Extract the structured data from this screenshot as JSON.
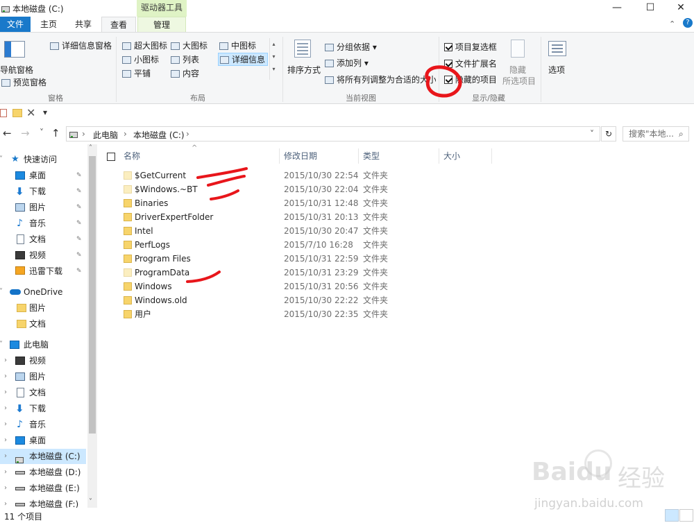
{
  "window": {
    "title": "本地磁盘 (C:)",
    "min_glyph": "—",
    "max_glyph": "☐",
    "close_glyph": "✕"
  },
  "tabs": {
    "context_header": "驱动器工具",
    "file": "文件",
    "home": "主页",
    "share": "共享",
    "view": "查看",
    "manage": "管理",
    "help_glyph": "?",
    "collapse_glyph": "⌃"
  },
  "ribbon": {
    "panes": {
      "label": "窗格",
      "nav_pane": "导航窗格",
      "preview_pane": "预览窗格",
      "details_pane": "详细信息窗格"
    },
    "layout": {
      "label": "布局",
      "items": [
        "超大图标",
        "大图标",
        "中图标",
        "小图标",
        "列表",
        "详细信息",
        "平铺",
        "内容"
      ]
    },
    "current_view": {
      "label": "当前视图",
      "sort_by": "排序方式",
      "group_by": "分组依据",
      "add_columns": "添加列",
      "fit_columns": "将所有列调整为合适的大小"
    },
    "show_hide": {
      "label": "显示/隐藏",
      "item_checkboxes": "项目复选框",
      "file_extensions": "文件扩展名",
      "hidden_items": "隐藏的项目",
      "hide_selected_1": "隐藏",
      "hide_selected_2": "所选项目",
      "options": "选项"
    }
  },
  "qat": {
    "dropdown_glyph": "▾"
  },
  "address": {
    "back_glyph": "←",
    "forward_glyph": "→",
    "recent_glyph": "˅",
    "up_glyph": "↑",
    "sep_glyph": "›",
    "crumbs": [
      "此电脑",
      "本地磁盘 (C:)"
    ],
    "dropdown_glyph": "˅",
    "refresh_glyph": "↻",
    "search_placeholder": "搜索\"本地...",
    "search_glyph": "⌕"
  },
  "nav": {
    "quick_access": "快速访问",
    "quick_items": [
      "桌面",
      "下载",
      "图片",
      "音乐",
      "文档",
      "视频",
      "迅雷下载"
    ],
    "onedrive": "OneDrive",
    "onedrive_items": [
      "图片",
      "文档"
    ],
    "this_pc": "此电脑",
    "pc_items": [
      "视频",
      "图片",
      "文档",
      "下载",
      "音乐",
      "桌面",
      "本地磁盘 (C:)",
      "本地磁盘 (D:)",
      "本地磁盘 (E:)",
      "本地磁盘 (F:)"
    ],
    "expand_glyph": "›",
    "expanded_glyph": "˅",
    "pin_glyph": "📌",
    "scroll_up": "˄",
    "scroll_down": "˅"
  },
  "files": {
    "columns": [
      "名称",
      "修改日期",
      "类型",
      "大小"
    ],
    "sort_glyph": "^",
    "type_label": "文件夹",
    "rows": [
      {
        "name": "$GetCurrent",
        "date": "2015/10/30 22:54",
        "hidden": true
      },
      {
        "name": "$Windows.~BT",
        "date": "2015/10/30 22:04",
        "hidden": true
      },
      {
        "name": "Binaries",
        "date": "2015/10/31 12:48",
        "hidden": false
      },
      {
        "name": "DriverExpertFolder",
        "date": "2015/10/31 20:13",
        "hidden": false
      },
      {
        "name": "Intel",
        "date": "2015/10/30 20:47",
        "hidden": false
      },
      {
        "name": "PerfLogs",
        "date": "2015/7/10 16:28",
        "hidden": false
      },
      {
        "name": "Program Files",
        "date": "2015/10/31 22:59",
        "hidden": false
      },
      {
        "name": "ProgramData",
        "date": "2015/10/31 23:29",
        "hidden": true
      },
      {
        "name": "Windows",
        "date": "2015/10/31 20:56",
        "hidden": false
      },
      {
        "name": "Windows.old",
        "date": "2015/10/30 22:22",
        "hidden": false
      },
      {
        "name": "用户",
        "date": "2015/10/30 22:35",
        "hidden": false
      }
    ]
  },
  "status": {
    "item_count": "11 个项目"
  },
  "watermark": {
    "brand": "Baidu",
    "cn": "经验",
    "url": "jingyan.baidu.com"
  },
  "colors": {
    "file_tab": "#1979ca",
    "selection": "#cce8ff",
    "annotation_red": "#e8161b",
    "folder": "#f7d46b"
  }
}
